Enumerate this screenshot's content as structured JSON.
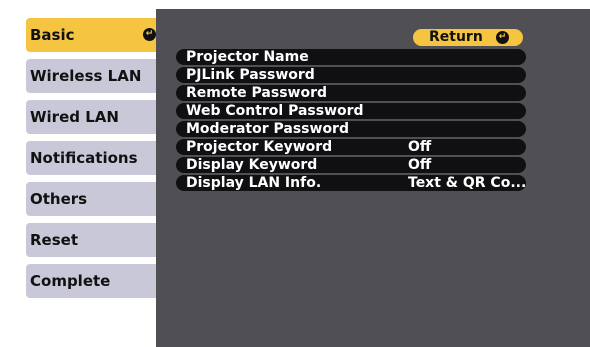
{
  "sidebar": {
    "tabs": [
      {
        "label": "Basic",
        "active": true
      },
      {
        "label": "Wireless LAN"
      },
      {
        "label": "Wired LAN"
      },
      {
        "label": "Notifications"
      },
      {
        "label": "Others"
      },
      {
        "label": "Reset"
      },
      {
        "label": "Complete"
      }
    ]
  },
  "panel": {
    "return_label": "Return",
    "rows": [
      {
        "label": "Projector Name",
        "value": ""
      },
      {
        "label": "PJLink Password",
        "value": ""
      },
      {
        "label": "Remote Password",
        "value": ""
      },
      {
        "label": "Web Control Password",
        "value": ""
      },
      {
        "label": "Moderator Password",
        "value": ""
      },
      {
        "label": "Projector Keyword",
        "value": "Off"
      },
      {
        "label": "Display Keyword",
        "value": "Off"
      },
      {
        "label": "Display LAN Info.",
        "value": "Text & QR Co..."
      }
    ]
  },
  "icons": {
    "enter": "enter-icon"
  },
  "colors": {
    "accent": "#f5c542",
    "panel_bg": "#505054",
    "row_bg": "#101012",
    "tab_bg": "#c8c8d8"
  }
}
